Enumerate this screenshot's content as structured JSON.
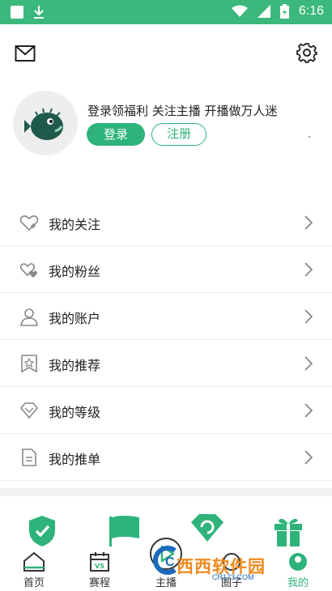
{
  "status_bar": {
    "time": "6:16"
  },
  "profile": {
    "slogan": "登录领福利 关注主播 开播做万人迷",
    "login_label": "登录",
    "register_label": "注册"
  },
  "menu": {
    "items": [
      {
        "label": "我的关注"
      },
      {
        "label": "我的粉丝"
      },
      {
        "label": "我的账户"
      },
      {
        "label": "我的推荐"
      },
      {
        "label": "我的等级"
      },
      {
        "label": "我的推单"
      }
    ]
  },
  "tabs": [
    {
      "label": "首页"
    },
    {
      "label": "赛程"
    },
    {
      "label": "主播"
    },
    {
      "label": "圈子"
    },
    {
      "label": "我的"
    }
  ],
  "colors": {
    "accent": "#2eb37a",
    "statusbar": "#3bb87c"
  },
  "watermark": {
    "main": "西西软件园",
    "sub": "CR173.COM",
    "logo_letter": "C"
  }
}
